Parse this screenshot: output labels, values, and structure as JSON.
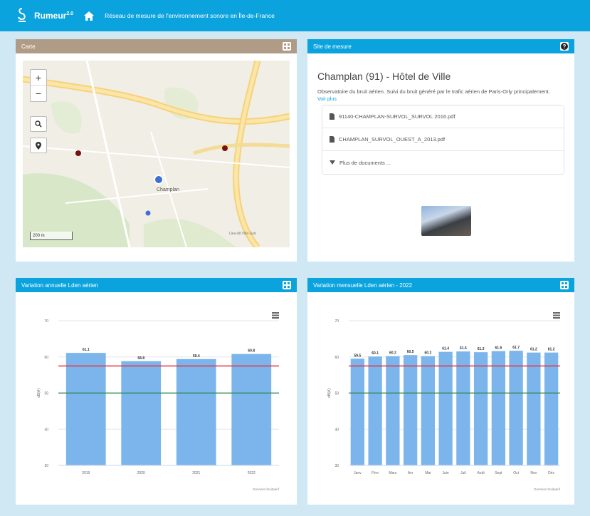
{
  "header": {
    "brand": "Rumeur",
    "brand_sup": "2.0",
    "subtitle": "Réseau de mesure de l'environnement sonore en Île-de-France"
  },
  "map_panel": {
    "title": "Carte",
    "zoom_in": "+",
    "zoom_out": "−",
    "place_label": "Champlan",
    "scale_label": "200 m",
    "corner_label": "Lieu-dit Ville-Sud"
  },
  "site_panel": {
    "title": "Site de mesure",
    "site_name": "Champlan (91) - Hôtel de Ville",
    "description": "Observatoire du bruit aérien. Suivi du bruit généré par le trafic aérien de Paris-Orly principalement.",
    "more_link": "Voir plus",
    "documents": [
      "91140-CHAMPLAN-SURVOL_SURVOL 2016.pdf",
      "CHAMPLAN_SURVOL_OUEST_A_2013.pdf"
    ],
    "more_documents": "Plus de documents ..."
  },
  "annual_panel": {
    "title": "Variation annuelle Lden aérien",
    "credits": "Données bruitparif"
  },
  "monthly_panel": {
    "title": "Variation mensuelle Lden aérien - 2022",
    "credits": "Données bruitparif"
  },
  "colors": {
    "header_blue": "#0ba3de",
    "bar_blue": "#7cb5ec",
    "threshold_red": "#e8343b",
    "threshold_green": "#2e8b57"
  },
  "chart_data": [
    {
      "type": "bar",
      "title": "Variation annuelle Lden aérien",
      "ylabel": "dB(A)",
      "categories": [
        "2019",
        "2020",
        "2021",
        "2022"
      ],
      "values": [
        61.1,
        58.8,
        59.4,
        60.8
      ],
      "data_labels": [
        "61.1",
        "58.8",
        "59.4",
        "60.8"
      ],
      "ylim": [
        30,
        70
      ],
      "yticks": [
        30,
        40,
        50,
        60,
        70
      ],
      "thresholds": [
        {
          "value": 57.5,
          "color": "red"
        },
        {
          "value": 50,
          "color": "green"
        }
      ],
      "credits": "Données bruitparif"
    },
    {
      "type": "bar",
      "title": "Variation mensuelle Lden aérien - 2022",
      "ylabel": "dB(A)",
      "categories": [
        "Janv",
        "Févr",
        "Mars",
        "Avr",
        "Mai",
        "Juin",
        "Juil",
        "Août",
        "Sept",
        "Oct",
        "Nov",
        "Déc"
      ],
      "values": [
        59.5,
        60.1,
        60.2,
        60.5,
        60.2,
        61.4,
        61.5,
        61.3,
        61.6,
        61.7,
        61.2,
        61.2
      ],
      "data_labels": [
        "59.5",
        "60.1",
        "60.2",
        "60.5",
        "60.2",
        "61.4",
        "61.5",
        "61.3",
        "61.6",
        "61.7",
        "61.2",
        "61.2"
      ],
      "ylim": [
        30,
        70
      ],
      "yticks": [
        30,
        40,
        50,
        60,
        70
      ],
      "thresholds": [
        {
          "value": 57.5,
          "color": "red"
        },
        {
          "value": 50,
          "color": "green"
        }
      ],
      "credits": "Données bruitparif"
    }
  ]
}
